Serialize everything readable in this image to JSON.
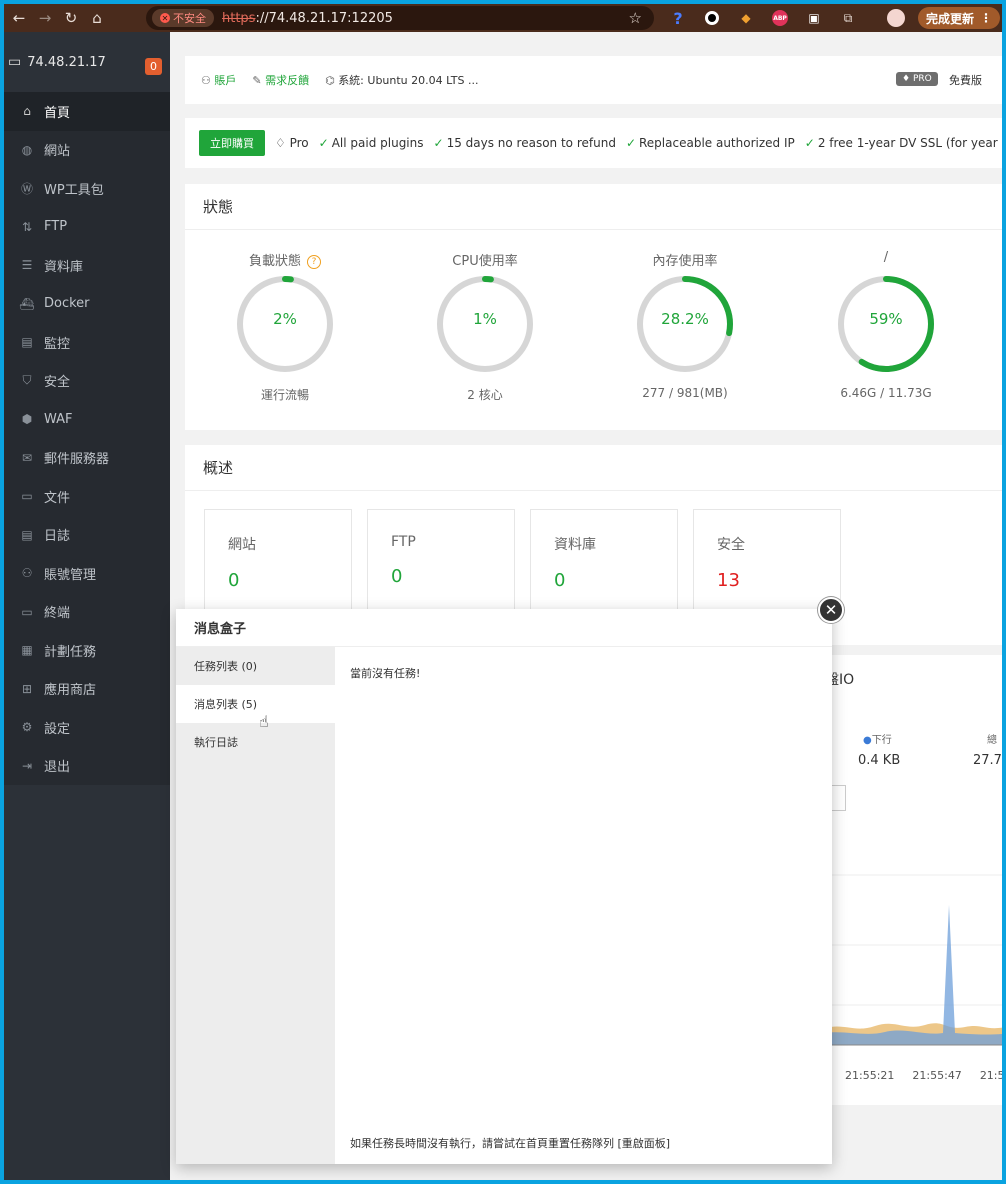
{
  "browser": {
    "insecure_label": "不安全",
    "url_scheme": "https",
    "url_rest": "://74.48.21.17:12205",
    "update_label": "完成更新"
  },
  "sidebar": {
    "host": "74.48.21.17",
    "badge": "0",
    "items": [
      {
        "label": "首頁",
        "icon": "home-icon"
      },
      {
        "label": "網站",
        "icon": "globe-icon"
      },
      {
        "label": "WP工具包",
        "icon": "wordpress-icon"
      },
      {
        "label": "FTP",
        "icon": "ftp-icon"
      },
      {
        "label": "資料庫",
        "icon": "database-icon"
      },
      {
        "label": "Docker",
        "icon": "docker-icon"
      },
      {
        "label": "監控",
        "icon": "monitor-icon"
      },
      {
        "label": "安全",
        "icon": "shield-icon"
      },
      {
        "label": "WAF",
        "icon": "waf-shield-icon"
      },
      {
        "label": "郵件服務器",
        "icon": "mail-icon"
      },
      {
        "label": "文件",
        "icon": "folder-icon"
      },
      {
        "label": "日誌",
        "icon": "log-icon"
      },
      {
        "label": "賬號管理",
        "icon": "users-icon"
      },
      {
        "label": "終端",
        "icon": "terminal-icon"
      },
      {
        "label": "計劃任務",
        "icon": "calendar-icon"
      },
      {
        "label": "應用商店",
        "icon": "apps-icon"
      },
      {
        "label": "設定",
        "icon": "gear-icon"
      },
      {
        "label": "退出",
        "icon": "logout-icon"
      }
    ]
  },
  "topbar": {
    "user": "賬戶",
    "feedback": "需求反饋",
    "system": "系統: Ubuntu 20.04 LTS ...",
    "pro_tag": "PRO",
    "edition": "免費版"
  },
  "probar": {
    "buy": "立即購買",
    "pro": "Pro",
    "features": [
      "All paid plugins",
      "15 days no reason to refund",
      "Replaceable authorized IP",
      "2 free 1-year DV SSL (for year"
    ]
  },
  "status": {
    "title": "狀態",
    "gauges": [
      {
        "label": "負載狀態",
        "value": "2%",
        "fraction": 0.02,
        "sub": "運行流暢",
        "help": "?"
      },
      {
        "label": "CPU使用率",
        "value": "1%",
        "fraction": 0.01,
        "sub": "2 核心"
      },
      {
        "label": "內存使用率",
        "value": "28.2%",
        "fraction": 0.282,
        "sub": "277 / 981(MB)"
      },
      {
        "label": "/",
        "value": "59%",
        "fraction": 0.59,
        "sub": "6.46G / 11.73G"
      }
    ]
  },
  "overview": {
    "title": "概述",
    "cards": [
      {
        "label": "網站",
        "value": "0"
      },
      {
        "label": "FTP",
        "value": "0"
      },
      {
        "label": "資料庫",
        "value": "0"
      },
      {
        "label": "安全",
        "value": "13"
      }
    ]
  },
  "traffic": {
    "title_fragment": "盤IO",
    "down_label": "下行",
    "down_value": "0.4 KB",
    "total_fragment": "總",
    "total_value": "27.7",
    "times": [
      "21:55:21",
      "21:55:47",
      "21:56:1"
    ]
  },
  "dialog": {
    "title": "消息盒子",
    "tabs": [
      "任務列表 (0)",
      "消息列表 (5)",
      "執行日誌"
    ],
    "empty": "當前沒有任務!",
    "footer": "如果任務長時間沒有執行，請嘗試在首頁重置任務隊列 [重啟面板]"
  },
  "colors": {
    "accent": "#20a53a",
    "danger": "#e02020",
    "sidebar": "#2c3138"
  }
}
